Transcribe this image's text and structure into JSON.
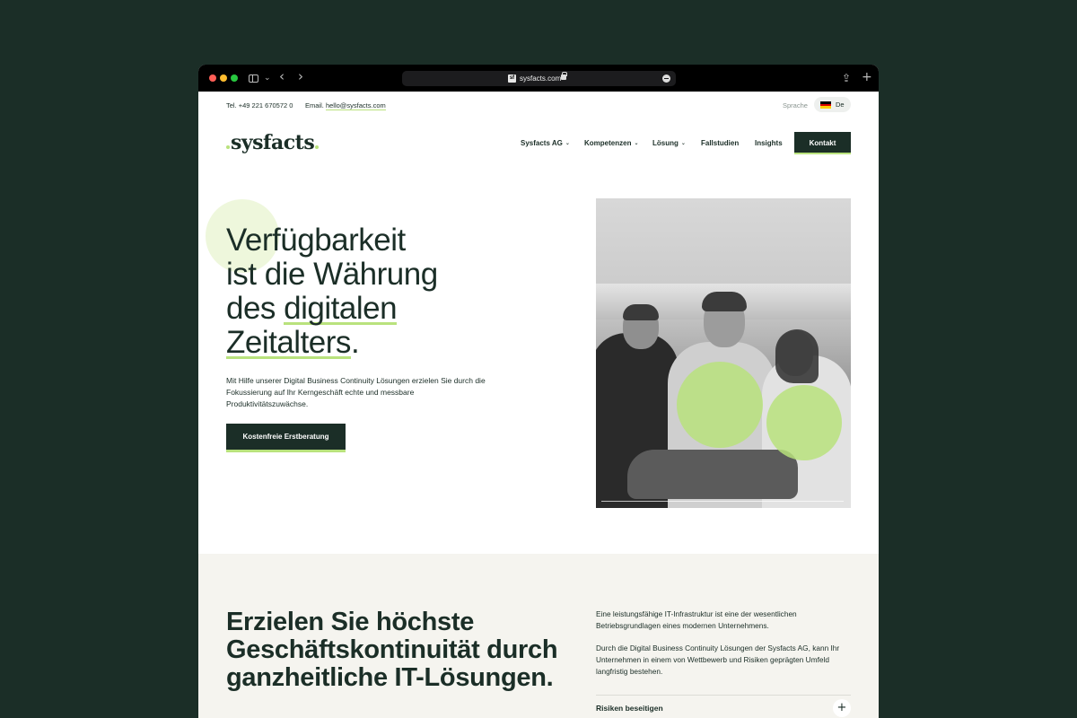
{
  "browser": {
    "url": "sysfacts.com",
    "favicon_text": "sf",
    "back_glyph": "‹",
    "forward_glyph": "›",
    "dropdown_glyph": "⌄",
    "share_glyph": "⇪",
    "new_tab_glyph": "+"
  },
  "topbar": {
    "tel": "Tel. +49 221 670572 0",
    "email_label": "Email.",
    "email": "hello@sysfacts.com",
    "language_label": "Sprache",
    "language": "De",
    "flag_colors": [
      "#000000",
      "#dd0000",
      "#ffce00"
    ]
  },
  "nav": {
    "logo": "sysfacts",
    "items": [
      {
        "label": "Sysfacts AG",
        "dropdown": true
      },
      {
        "label": "Kompetenzen",
        "dropdown": true
      },
      {
        "label": "Lösung",
        "dropdown": true
      },
      {
        "label": "Fallstudien",
        "dropdown": false
      },
      {
        "label": "Insights",
        "dropdown": false
      }
    ],
    "chevron": "⌄",
    "contact": "Kontakt"
  },
  "hero": {
    "line1": "Verfügbarkeit",
    "line2": "ist die Währung",
    "line3_pre": "des ",
    "line3_hl": "digitalen",
    "line4_hl": "Zeitalters",
    "line4_post": ".",
    "text": "Mit Hilfe unserer Digital Business Continuity Lösungen erzielen Sie durch die Fokussierung auf Ihr Kerngeschäft echte und messbare Produktivitätszuwächse.",
    "cta": "Kostenfreie Erstberatung"
  },
  "lower": {
    "title_lines": [
      "Erzielen Sie höchste",
      "Geschäftskontinuität durch",
      "ganzheitliche IT-Lösungen."
    ],
    "para1": "Eine leistungsfähige IT-Infrastruktur ist eine der wesentlichen Betriebsgrundlagen eines modernen Unternehmens.",
    "para2": "Durch die Digital Business Continuity Lösungen der Sysfacts AG, kann Ihr Unternehmen in einem von Wettbewerb und Risiken geprägten Umfeld langfristig bestehen.",
    "accordion_item": "Risiken beseitigen",
    "accordion_icon": "+"
  },
  "colors": {
    "brand_dark": "#1b2e27",
    "accent_green": "#b9e27d",
    "section_bg": "#f5f4ef"
  }
}
